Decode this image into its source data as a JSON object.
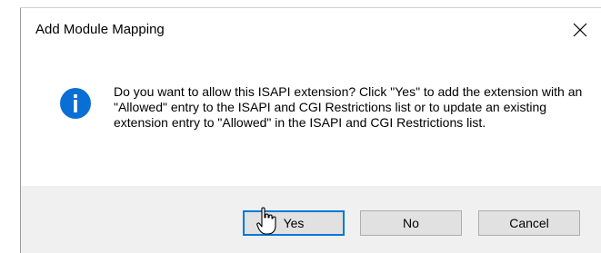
{
  "window": {
    "title": "Add Module Mapping",
    "close_glyph": "✕"
  },
  "dialog": {
    "icon": "info-icon",
    "message": "Do you want to allow this ISAPI extension? Click \"Yes\" to add the extension with an \"Allowed\" entry to the ISAPI and CGI Restrictions list or to update an existing extension entry to \"Allowed\" in the ISAPI and CGI Restrictions list."
  },
  "buttons": {
    "yes_label": "Yes",
    "no_label": "No",
    "cancel_label": "Cancel",
    "default": "yes"
  },
  "colors": {
    "accent": "#0078d7",
    "footer_bg": "#f0f0f0",
    "button_bg": "#e1e1e1"
  },
  "cursor": "hand-pointer-cursor"
}
